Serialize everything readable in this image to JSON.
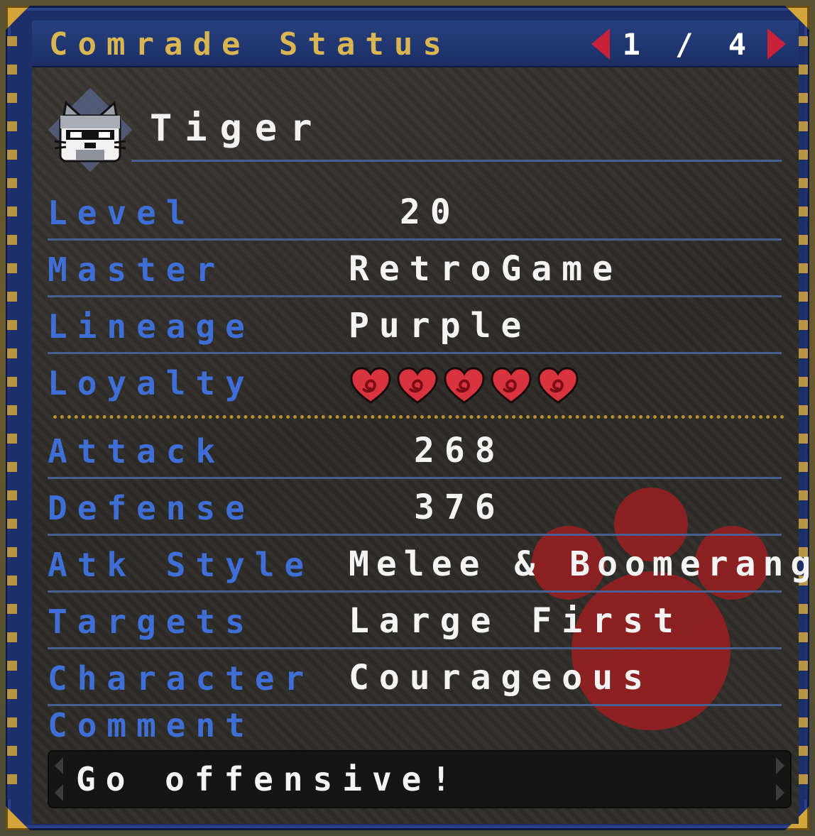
{
  "window": {
    "title": "Comrade Status",
    "page": "1 / 4"
  },
  "comrade": {
    "name": "Tiger",
    "avatar_icon": "palico-cat-icon"
  },
  "stats": [
    {
      "key": "level",
      "label": "Level",
      "value": "20"
    },
    {
      "key": "master",
      "label": "Master",
      "value": "RetroGame"
    },
    {
      "key": "lineage",
      "label": "Lineage",
      "value": "Purple"
    },
    {
      "key": "loyalty",
      "label": "Loyalty",
      "value": 5,
      "max": 5,
      "icon": "heart-icon"
    },
    {
      "key": "attack",
      "label": "Attack",
      "value": "268"
    },
    {
      "key": "defense",
      "label": "Defense",
      "value": "376"
    },
    {
      "key": "atk_style",
      "label": "Atk Style",
      "value": "Melee & Boomerang"
    },
    {
      "key": "targets",
      "label": "Targets",
      "value": "Large First"
    },
    {
      "key": "character",
      "label": "Character",
      "value": "Courageous"
    }
  ],
  "comment": {
    "label": "Comment",
    "text": "Go offensive!"
  },
  "colors": {
    "frame": "#1d2f6b",
    "title_gold": "#d9b652",
    "label_blue": "#3f6fd6",
    "value_white": "#f4f4f4",
    "accent_red": "#c8213a",
    "paw_red": "#9c1e22"
  }
}
